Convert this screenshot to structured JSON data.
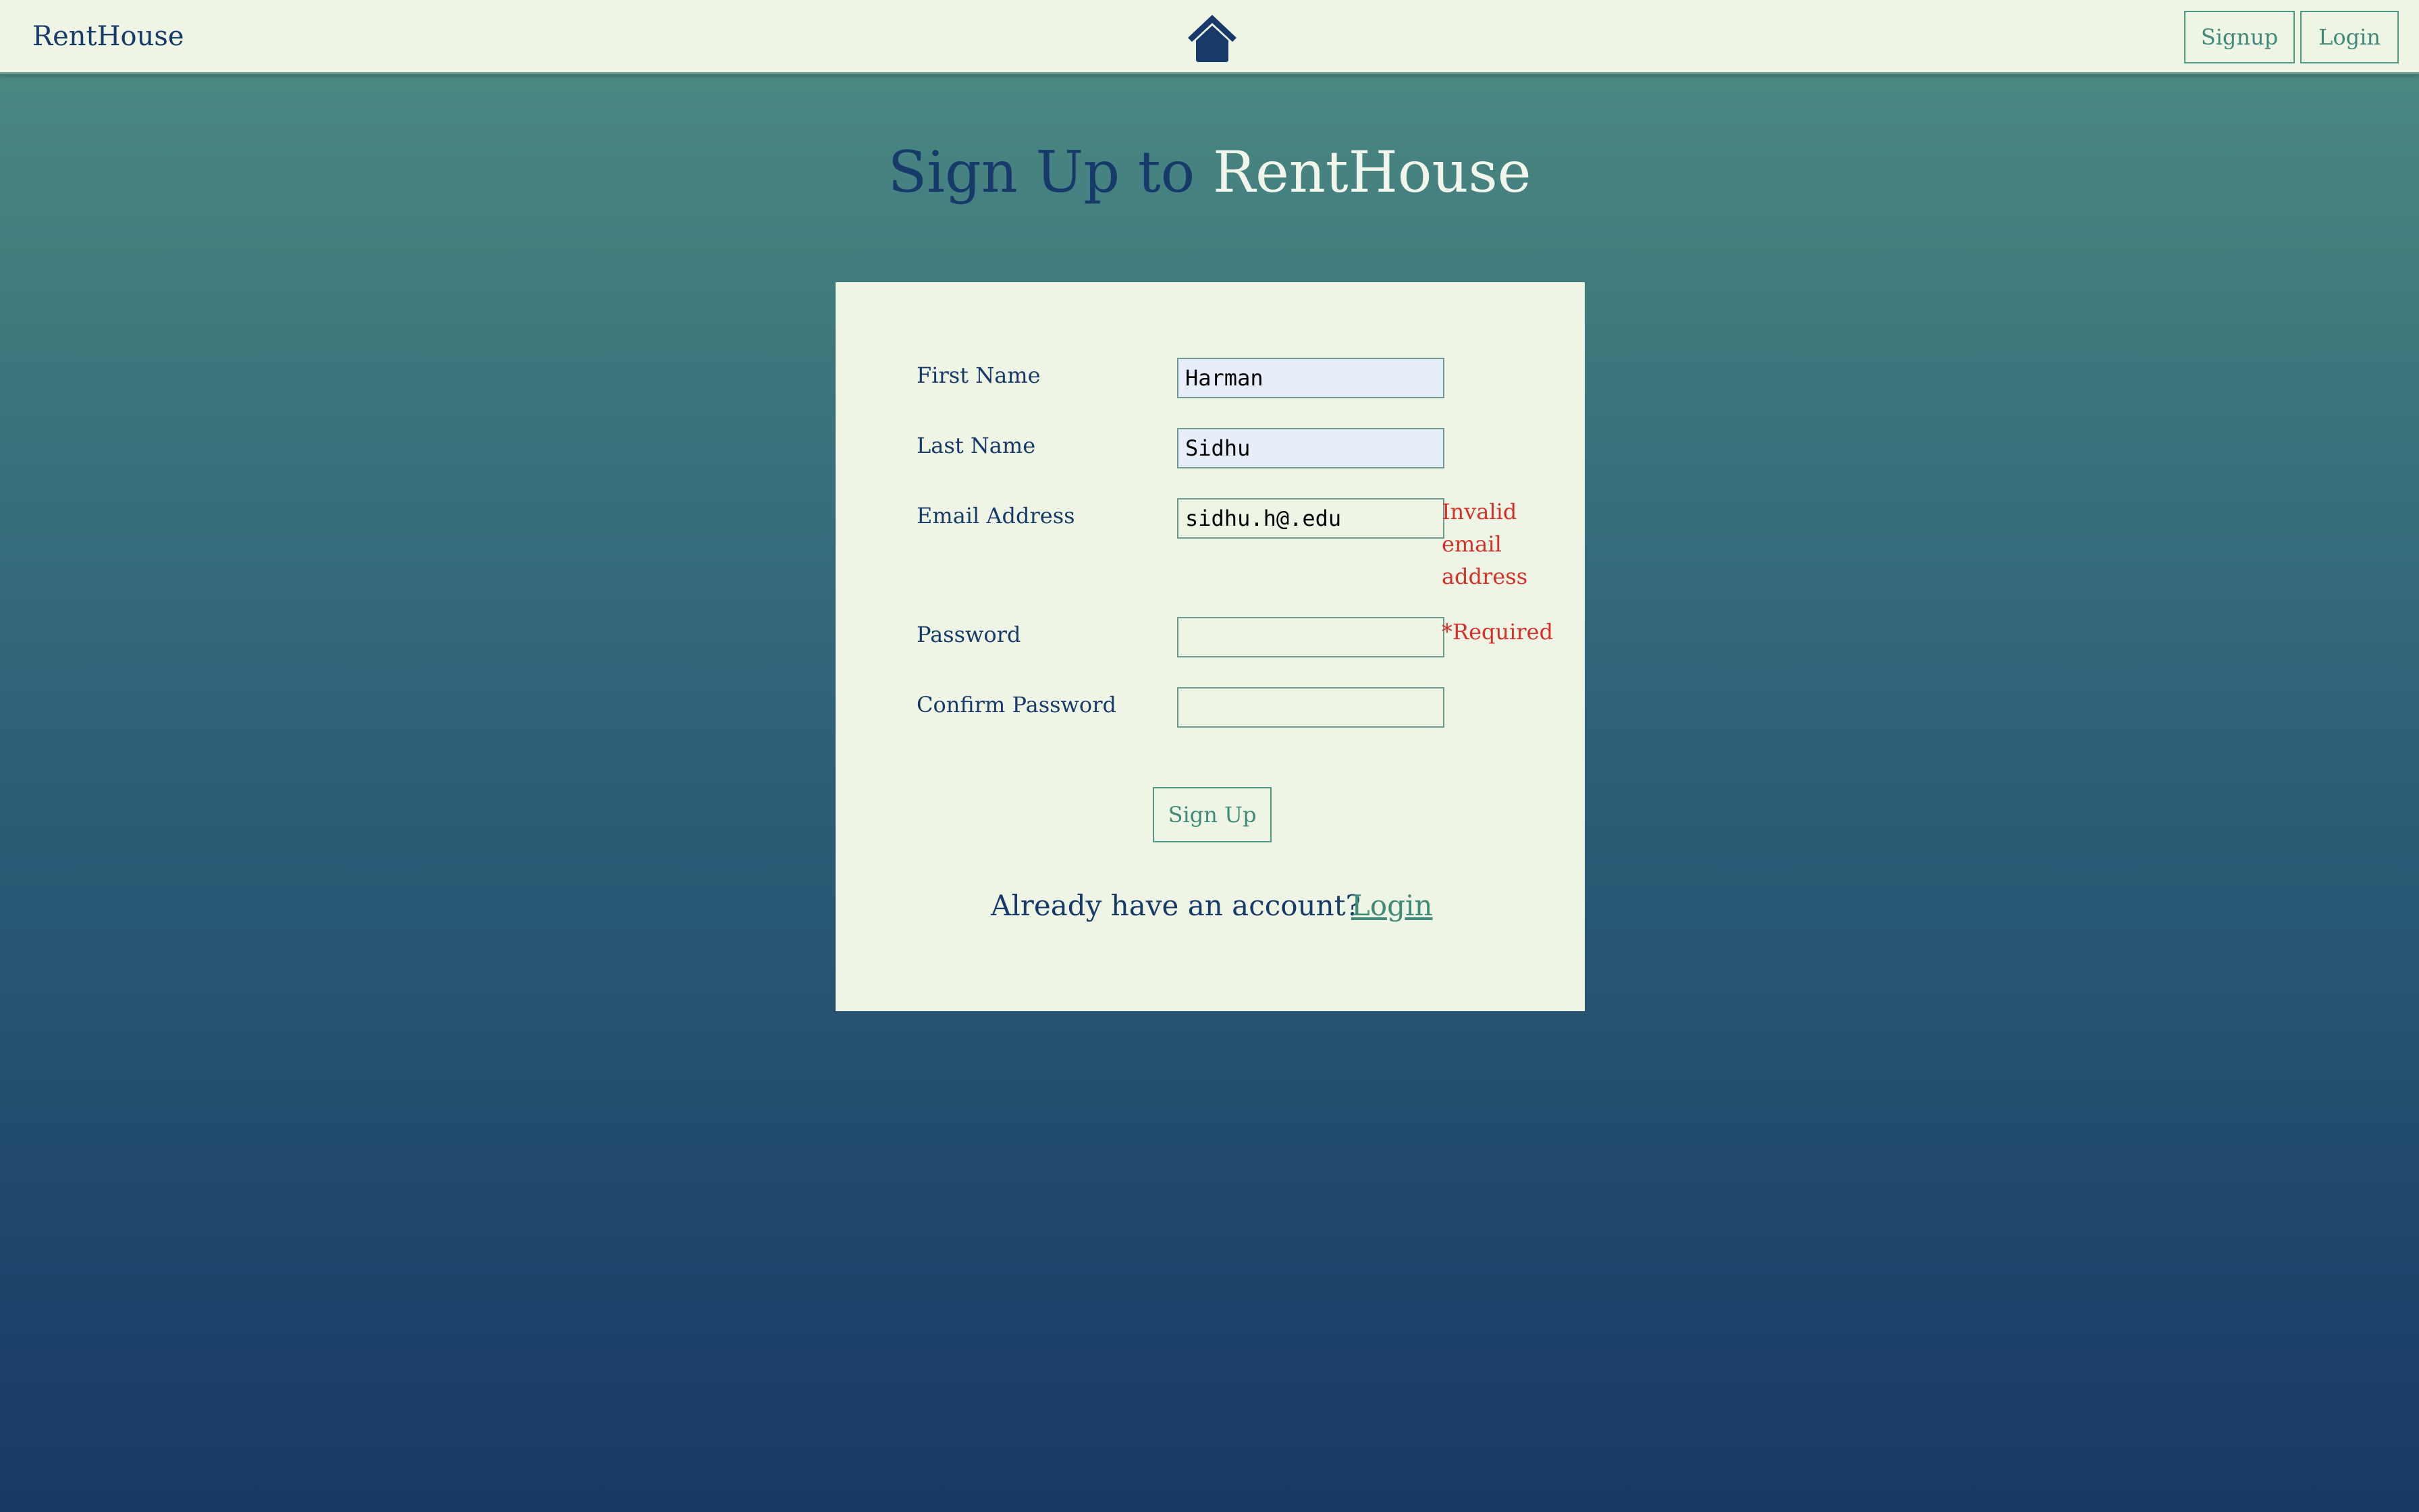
{
  "navbar": {
    "brand": "RentHouse",
    "logo_icon": "house-icon",
    "signup_label": "Signup",
    "login_label": "Login"
  },
  "title": {
    "part1": "Sign Up to",
    "part2": "RentHouse"
  },
  "form": {
    "first_name": {
      "label": "First Name",
      "value": "Harman"
    },
    "last_name": {
      "label": "Last Name",
      "value": "Sidhu"
    },
    "email": {
      "label": "Email Address",
      "value": "sidhu.h@.edu",
      "error": "Invalid email address"
    },
    "password": {
      "label": "Password",
      "value": "",
      "error": "*Required"
    },
    "confirm_password": {
      "label": "Confirm Password",
      "value": ""
    },
    "submit_label": "Sign Up",
    "prompt_text": "Already have an account?",
    "login_link": "Login"
  },
  "colors": {
    "navy": "#173a6b",
    "accent_green": "#3f8a78",
    "error_red": "#d6302a",
    "card_bg": "#eef5e4"
  }
}
